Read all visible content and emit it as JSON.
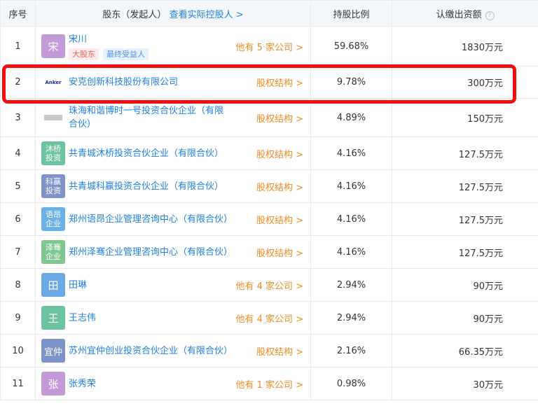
{
  "header": {
    "index": "序号",
    "shareholder": "股东（发起人）",
    "controller_link": "查看实际控股人 >",
    "ratio": "持股比例",
    "amount": "认缴出资额",
    "help_glyph": "?"
  },
  "rows": [
    {
      "index": "1",
      "avatar": "宋",
      "avatar_color": "#c39ad8",
      "name": "宋川",
      "tags": [
        "大股东",
        "最终受益人"
      ],
      "link": "他有 5 家公司 >",
      "ratio": "59.68%",
      "amount": "1830万元"
    },
    {
      "index": "2",
      "avatar_logo": "Anker",
      "name": "安克创新科技股份有限公司",
      "link": "股权结构 >",
      "ratio": "9.78%",
      "amount": "300万元"
    },
    {
      "index": "3",
      "name": "珠海和谐博时一号投资合伙企业（有限合伙）",
      "link": "股权结构 >",
      "ratio": "4.89%",
      "amount": "150万元"
    },
    {
      "index": "4",
      "avatar_lines": [
        "沐桥",
        "投资"
      ],
      "avatar_color": "#6cc3a0",
      "name": "共青城沐桥投资合伙企业（有限合伙）",
      "link": "股权结构 >",
      "ratio": "4.16%",
      "amount": "127.5万元"
    },
    {
      "index": "5",
      "avatar_lines": [
        "科赢",
        "投资"
      ],
      "avatar_color": "#7d93c9",
      "name": "共青城科赢投资合伙企业（有限合伙）",
      "link": "股权结构 >",
      "ratio": "4.16%",
      "amount": "127.5万元"
    },
    {
      "index": "6",
      "avatar_lines": [
        "语昂",
        "企业"
      ],
      "avatar_color": "#6ab0e8",
      "name": "郑州语昂企业管理咨询中心（有限合伙）",
      "link": "股权结构 >",
      "ratio": "4.16%",
      "amount": "127.5万元"
    },
    {
      "index": "7",
      "avatar_lines": [
        "泽骞",
        "企业"
      ],
      "avatar_color": "#7fc78f",
      "name": "郑州泽骞企业管理咨询中心（有限合伙）",
      "link": "股权结构 >",
      "ratio": "4.16%",
      "amount": "127.5万元"
    },
    {
      "index": "8",
      "avatar": "田",
      "avatar_color": "#6aa9e6",
      "name": "田琳",
      "link": "他有 4 家公司 >",
      "ratio": "2.94%",
      "amount": "90万元"
    },
    {
      "index": "9",
      "avatar": "王",
      "avatar_color": "#6cc3a0",
      "name": "王志伟",
      "link": "他有 4 家公司 >",
      "ratio": "2.94%",
      "amount": "90万元"
    },
    {
      "index": "10",
      "avatar": "宜仲",
      "avatar_color": "#7d93c9",
      "name": "苏州宜仲创业投资合伙企业（有限合伙）",
      "link": "股权结构 >",
      "ratio": "2.16%",
      "amount": "66.35万元"
    },
    {
      "index": "11",
      "avatar": "张",
      "avatar_color": "#c39ad8",
      "name": "张秀荣",
      "link": "他有 1 家公司 >",
      "ratio": "0.98%",
      "amount": "30万元"
    }
  ],
  "highlight": {
    "row_index": "2",
    "color": "#f50d0d"
  },
  "colors": {
    "link": "#1e7fe0",
    "orange_link": "#f08a24",
    "header_bg": "#f3f6fa"
  }
}
